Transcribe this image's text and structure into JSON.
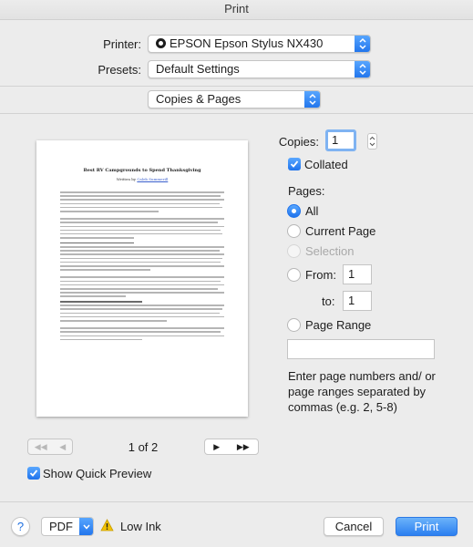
{
  "window": {
    "title": "Print"
  },
  "printer": {
    "label": "Printer:",
    "value": "EPSON Epson Stylus NX430"
  },
  "presets": {
    "label": "Presets:",
    "value": "Default Settings"
  },
  "section": {
    "value": "Copies & Pages"
  },
  "preview": {
    "doc_title": "Best RV Campgrounds to Spend Thanksgiving",
    "doc_byline_prefix": "Written by",
    "doc_byline_name": "Caleb Summerill",
    "page_indicator": "1 of 2",
    "nav_first": "◀◀",
    "nav_prev": "◀",
    "nav_next": "▶",
    "nav_last": "▶▶"
  },
  "copies": {
    "label": "Copies:",
    "value": "1"
  },
  "collated": {
    "label": "Collated",
    "checked": true
  },
  "pages": {
    "label": "Pages:",
    "all": "All",
    "current": "Current Page",
    "selection": "Selection",
    "from_label": "From:",
    "from_value": "1",
    "to_label": "to:",
    "to_value": "1",
    "range_label": "Page Range",
    "range_value": "",
    "hint": "Enter page numbers and/ or page ranges separated by commas (e.g. 2, 5-8)"
  },
  "quick_preview": {
    "label": "Show Quick Preview",
    "checked": true
  },
  "footer": {
    "help": "?",
    "pdf": "PDF",
    "low_ink": "Low Ink",
    "cancel": "Cancel",
    "print": "Print"
  },
  "colors": {
    "accent": "#1f73ec",
    "warning": "#f2c200"
  }
}
